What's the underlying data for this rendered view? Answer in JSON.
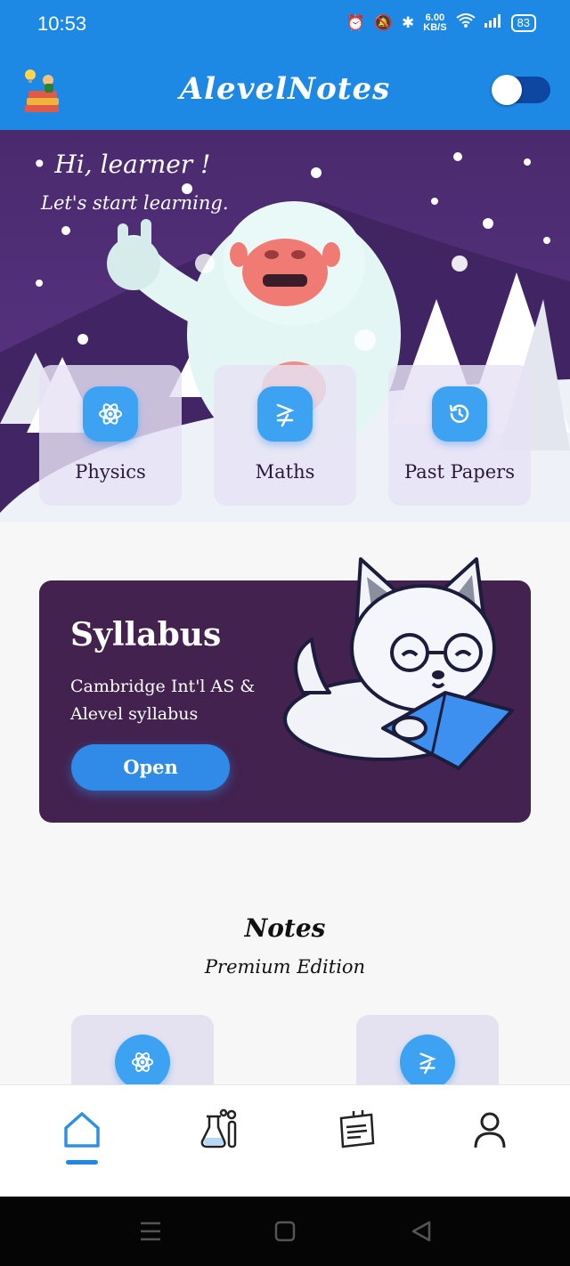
{
  "status_bar": {
    "time": "10:53",
    "net_speed_value": "6.00",
    "net_speed_unit": "KB/S",
    "battery": "83"
  },
  "app_bar": {
    "title": "AlevelNotes",
    "theme_toggle_on": false
  },
  "hero": {
    "greeting": "• Hi, learner !",
    "subtitle": "Let's start learning."
  },
  "subjects": [
    {
      "label": "Physics",
      "icon": "atom-icon"
    },
    {
      "label": "Maths",
      "icon": "not-greater-equal-icon"
    },
    {
      "label": "Past Papers",
      "icon": "history-icon"
    }
  ],
  "syllabus": {
    "title": "Syllabus",
    "description": "Cambridge Int'l AS & Alevel syllabus",
    "button_label": "Open"
  },
  "notes": {
    "title": "Notes",
    "subtitle": "Premium Edition",
    "cards": [
      {
        "icon": "atom-icon"
      },
      {
        "icon": "not-greater-equal-icon"
      }
    ]
  },
  "bottom_nav": {
    "items": [
      {
        "name": "home",
        "icon": "home-icon",
        "active": true
      },
      {
        "name": "lab",
        "icon": "lab-flask-icon",
        "active": false
      },
      {
        "name": "notes",
        "icon": "notepad-icon",
        "active": false
      },
      {
        "name": "profile",
        "icon": "user-icon",
        "active": false
      }
    ]
  },
  "colors": {
    "primary": "#1e88e5",
    "hero_purple": "#4a2a6e",
    "syllabus_bg": "#43224f",
    "icon_tile": "#3ea2f2"
  }
}
